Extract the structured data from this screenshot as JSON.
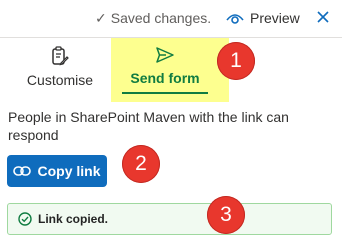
{
  "header": {
    "saved_text": "Saved changes.",
    "preview_label": "Preview"
  },
  "tabs": [
    {
      "label": "Customise",
      "icon": "clipboard-edit-icon",
      "active": false
    },
    {
      "label": "Send form",
      "icon": "send-icon",
      "active": true
    }
  ],
  "share": {
    "description": "People in SharePoint Maven with the link can respond",
    "copy_button_label": "Copy link",
    "toast_text": "Link copied."
  },
  "annotations": [
    "1",
    "2",
    "3"
  ],
  "colors": {
    "accent_green": "#107c41",
    "primary_blue": "#0f6cbd",
    "highlight_yellow": "#fdff8f",
    "badge_red": "#e8372d",
    "toast_bg": "#f1faf1"
  }
}
